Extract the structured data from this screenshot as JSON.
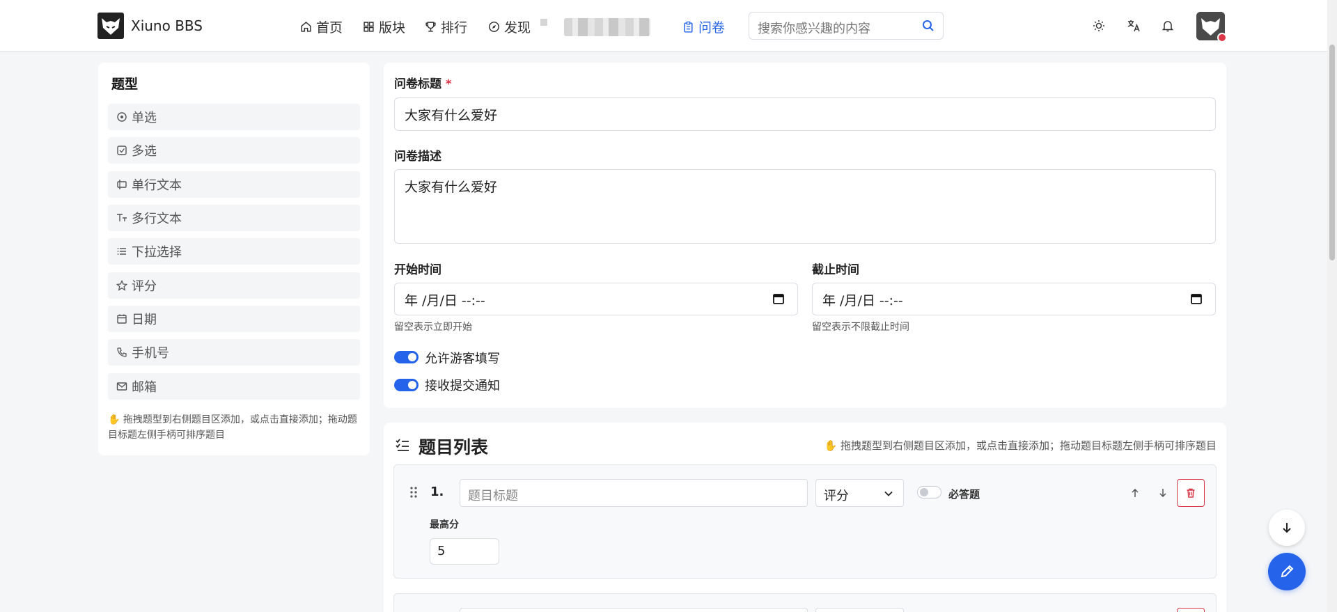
{
  "header": {
    "brand": "Xiuno BBS",
    "nav": [
      {
        "label": "首页",
        "icon": "home-icon"
      },
      {
        "label": "版块",
        "icon": "grid-icon"
      },
      {
        "label": "排行",
        "icon": "trophy-icon"
      },
      {
        "label": "发现",
        "icon": "compass-icon"
      },
      {
        "label": "问卷",
        "icon": "clipboard-icon"
      }
    ],
    "search_placeholder": "搜索你感兴趣的内容",
    "accent_color": "#2563eb"
  },
  "sidebar": {
    "title": "题型",
    "items": [
      {
        "label": "单选",
        "icon": "radio-icon"
      },
      {
        "label": "多选",
        "icon": "checkbox-icon"
      },
      {
        "label": "单行文本",
        "icon": "text-input-icon"
      },
      {
        "label": "多行文本",
        "icon": "text-size-icon"
      },
      {
        "label": "下拉选择",
        "icon": "list-icon"
      },
      {
        "label": "评分",
        "icon": "star-icon"
      },
      {
        "label": "日期",
        "icon": "calendar-icon"
      },
      {
        "label": "手机号",
        "icon": "phone-icon"
      },
      {
        "label": "邮箱",
        "icon": "mail-icon"
      }
    ],
    "hint": "拖拽题型到右侧题目区添加，或点击直接添加；拖动题目标题左侧手柄可排序题目"
  },
  "form": {
    "title_label": "问卷标题",
    "required_mark": "*",
    "title_value": "大家有什么爱好",
    "desc_label": "问卷描述",
    "desc_value": "大家有什么爱好",
    "start_label": "开始时间",
    "start_value": "年 /月/日 --:--",
    "start_hint": "留空表示立即开始",
    "end_label": "截止时间",
    "end_value": "年 /月/日 --:--",
    "end_hint": "留空表示不限截止时间",
    "allow_guest_label": "允许游客填写",
    "allow_guest": true,
    "notify_label": "接收提交通知",
    "notify": true
  },
  "questions": {
    "title": "题目列表",
    "hint": "拖拽题型到右侧题目区添加，或点击直接添加；拖动题目标题左侧手柄可排序题目",
    "items": [
      {
        "number": "1.",
        "title_placeholder": "题目标题",
        "type": "评分",
        "required_label": "必答题",
        "required": false,
        "max_label": "最高分",
        "max_value": "5"
      }
    ]
  }
}
